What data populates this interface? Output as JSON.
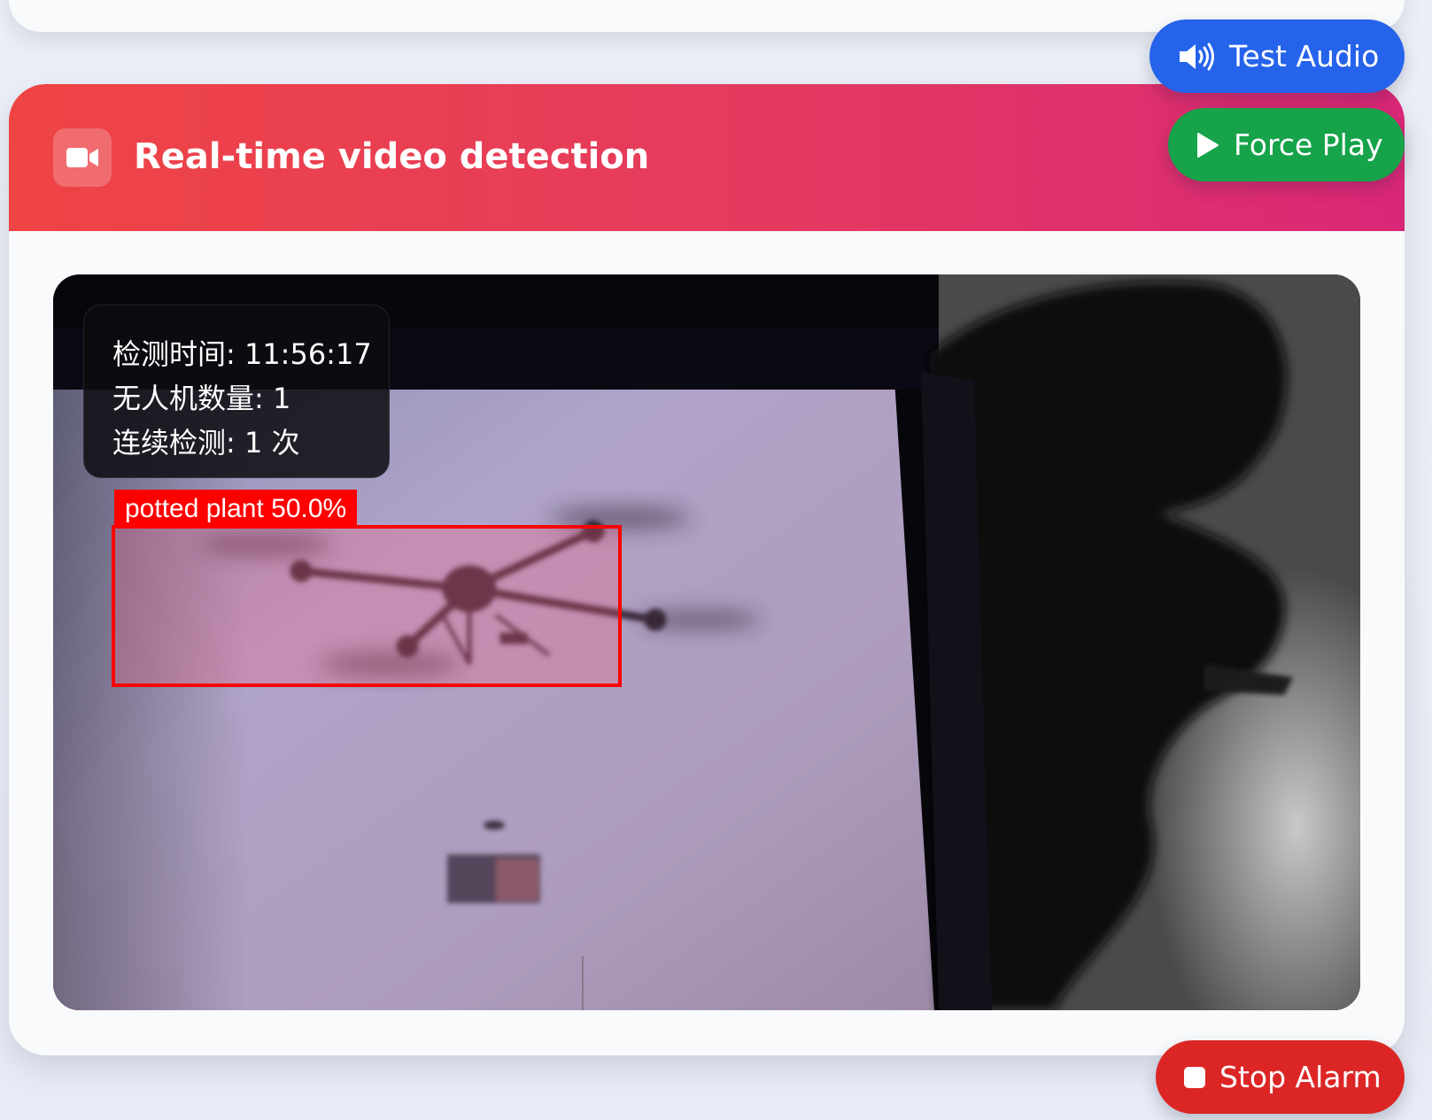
{
  "header": {
    "title": "Real-time video detection",
    "icon": "video-camera-icon"
  },
  "overlay": {
    "detect_time": "检测时间: 11:56:17",
    "drone_count": "无人机数量: 1",
    "consecutive": "连续检测: 1 次"
  },
  "detection": {
    "label": "potted plant 50.0%",
    "box_color": "#ff0000"
  },
  "buttons": {
    "test_audio": {
      "label": "Test Audio",
      "icon": "speaker-icon",
      "color": "#2563eb"
    },
    "force_play": {
      "label": "Force Play",
      "icon": "play-icon",
      "color": "#16a34a"
    },
    "stop_alarm": {
      "label": "Stop Alarm",
      "icon": "stop-icon",
      "color": "#dc2626"
    }
  },
  "colors": {
    "header_gradient_start": "#ef4444",
    "header_gradient_end": "#db2777"
  }
}
